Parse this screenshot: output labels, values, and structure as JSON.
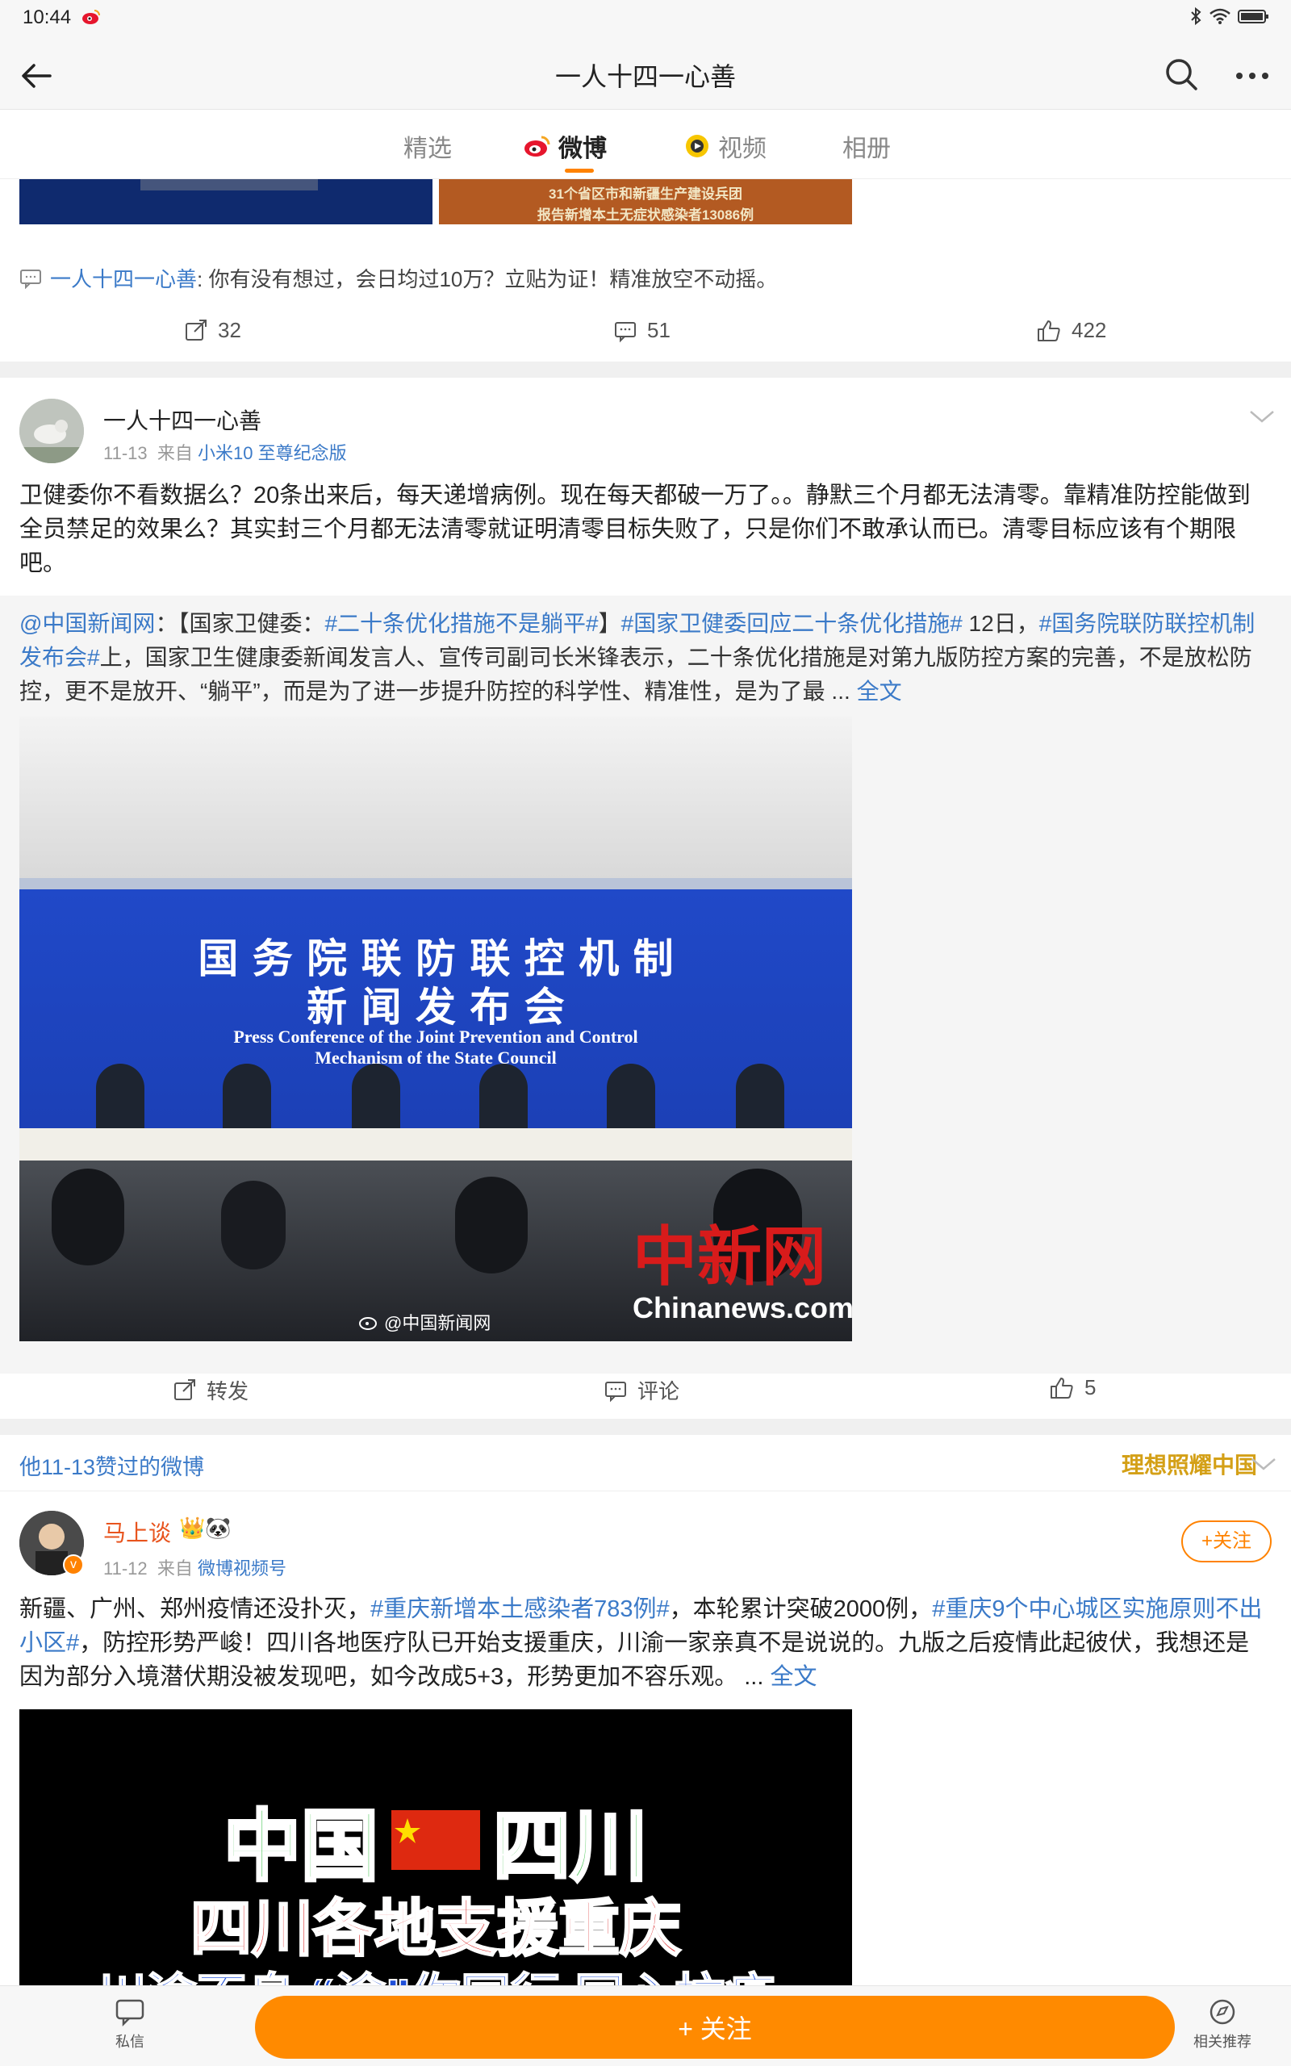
{
  "status_bar": {
    "time": "10:44"
  },
  "header": {
    "title": "一人十四一心善"
  },
  "tabs": [
    {
      "label": "精选"
    },
    {
      "label": "微博"
    },
    {
      "label": "视频"
    },
    {
      "label": "相册"
    }
  ],
  "prev_post": {
    "strip_text_b1": "31个省区市和新疆生产建设兵团",
    "strip_text_b2": "报告新增本土无症状感染者13086例",
    "quote_user": "一人十四一心善",
    "quote_text": ": 你有没有想过，会日均过10万？立贴为证！精准放空不动摇。",
    "repost_count": "32",
    "comment_count": "51",
    "like_count": "422"
  },
  "post1": {
    "user_name": "一人十四一心善",
    "date": "11-13",
    "from_label": "来自",
    "source": "小米10 至尊纪念版",
    "text": "卫健委你不看数据么？20条出来后，每天递增病例。现在每天都破一万了。。静默三个月都无法清零。靠精准防控能做到全员禁足的效果么？其实封三个月都无法清零就证明清零目标失败了，只是你们不敢承认而已。清零目标应该有个期限吧。",
    "repost": {
      "author": "@中国新闻网",
      "sep": "：【国家卫健委：",
      "tag1": "#二十条优化措施不是躺平#",
      "mid1": "】",
      "tag2": "#国家卫健委回应二十条优化措施#",
      "mid2": " 12日，",
      "tag3": "#国务院联防联控机制发布会#",
      "body": "上，国家卫生健康委新闻发言人、宣传司副司长米锋表示，二十条优化措施是对第九版防控方案的完善，不是放松防控，更不是放开、“躺平”，而是为了进一步提升防控的科学性、精准性，是为了最 ... ",
      "full": "全文",
      "image_title_1": "国 务 院 联 防 联 控 机 制",
      "image_title_2": "新 闻 发 布 会",
      "image_en_1": "Press Conference of the Joint Prevention and Control",
      "image_en_2": "Mechanism of the State Council",
      "watermark_logo": "中新网",
      "watermark_site": "Chinanews.com",
      "watermark_weibo": "@中国新闻网"
    },
    "repost_label": "转发",
    "comment_label": "评论",
    "like_count": "5"
  },
  "liked_section": {
    "label": "他11-13赞过的微博",
    "brand": "理想照耀中国"
  },
  "post2": {
    "user_name": "马上谈",
    "user_badges": "👑🐼",
    "date": "11-12",
    "from_label": "来自",
    "source": "微博视频号",
    "follow_label": "+关注",
    "t1": "新疆、广州、郑州疫情还没扑灭，",
    "tag1": "#重庆新增本土感染者783例#",
    "t2": "，本轮累计突破2000例，",
    "tag2": "#重庆9个中心城区实施原则不出小区#",
    "t3": "，防控形势严峻！四川各地医疗队已开始支援重庆，川渝一家亲真不是说说的。九版之后疫情此起彼伏，我想还是因为部分入境潜伏期没被发现吧，如今改成5+3，形势更加不容乐观。 ... ",
    "full": "全文",
    "video_line1_a": "中国",
    "video_line1_b": "四川",
    "video_line2": "四川各地支援重庆",
    "video_line3": "川渝不息 “渝”你同行 同心抗疫"
  },
  "bottom": {
    "message_label": "私信",
    "follow_label": "+ 关注",
    "recommend_label": "相关推荐"
  },
  "colors": {
    "accent": "#ff8200",
    "link": "#3b7ac8"
  }
}
